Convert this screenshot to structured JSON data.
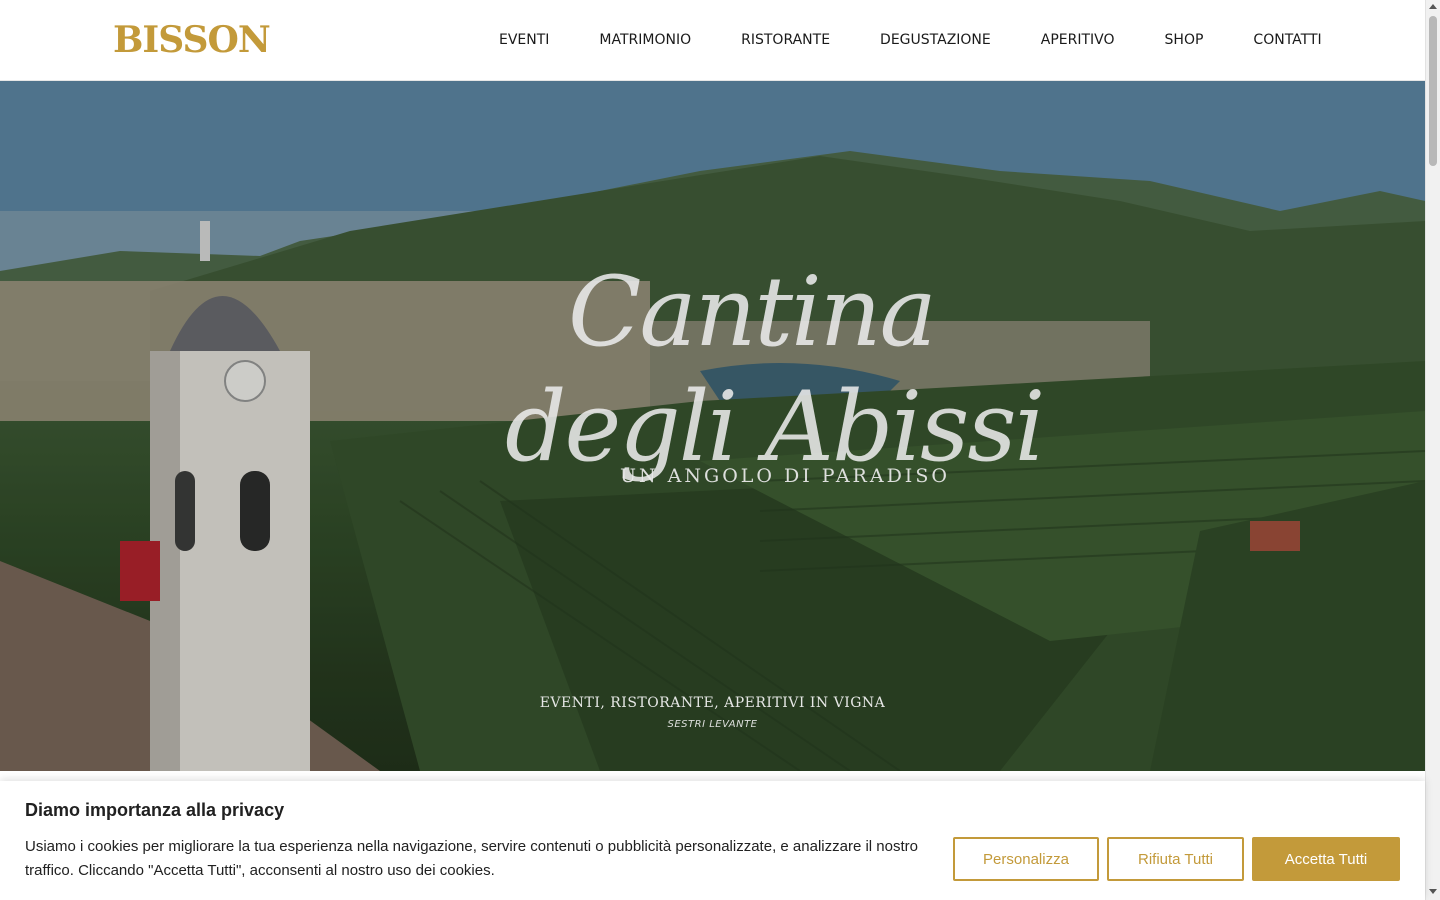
{
  "brand": {
    "logo_text": "BISSON",
    "accent_color": "#c39a3a"
  },
  "nav": {
    "items": [
      {
        "label": "EVENTI"
      },
      {
        "label": "MATRIMONIO"
      },
      {
        "label": "RISTORANTE"
      },
      {
        "label": "DEGUSTAZIONE"
      },
      {
        "label": "APERITIVO"
      },
      {
        "label": "SHOP"
      },
      {
        "label": "CONTATTI"
      }
    ]
  },
  "hero": {
    "script_line1": "Cantina",
    "script_line2": "degli Abissi",
    "tagline": "UN ANGOLO DI PARADISO",
    "subtitle": "EVENTI, RISTORANTE, APERITIVI IN VIGNA",
    "location": "SESTRI LEVANTE"
  },
  "cookie": {
    "title": "Diamo importanza alla privacy",
    "text": "Usiamo i cookies per migliorare la tua esperienza nella navigazione, servire contenuti o pubblicità personalizzate, e analizzare il nostro traffico. Cliccando \"Accetta Tutti\", acconsenti al nostro uso dei cookies.",
    "customize_label": "Personalizza",
    "reject_label": "Rifiuta Tutti",
    "accept_label": "Accetta Tutti"
  }
}
